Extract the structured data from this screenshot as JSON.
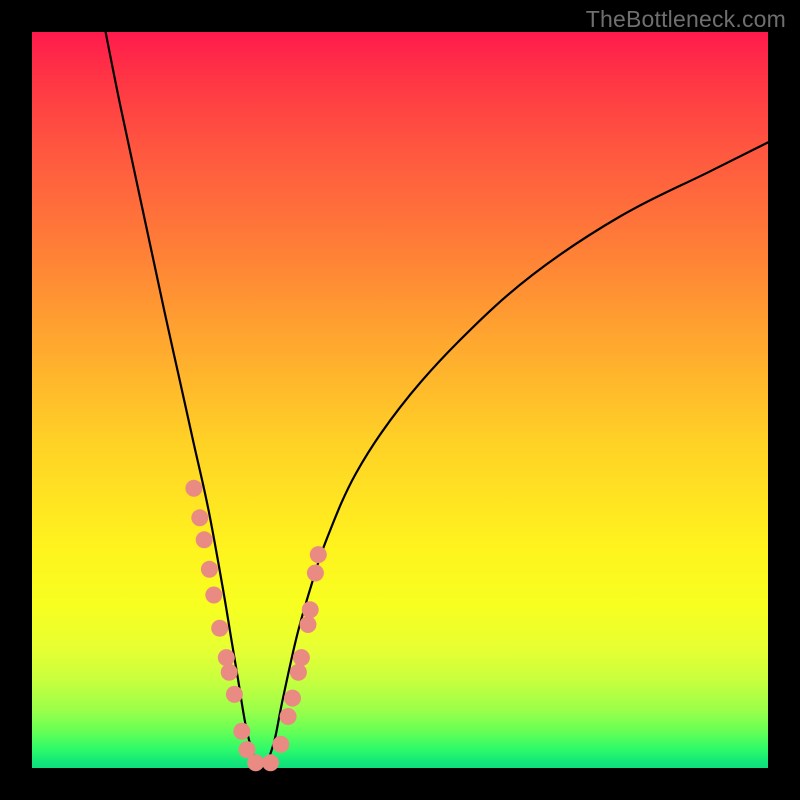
{
  "watermark": "TheBottleneck.com",
  "colors": {
    "frame": "#000000",
    "curve": "#000000",
    "dots": "#e98b83",
    "gradient_top": "#ff1a4d",
    "gradient_bottom": "#0fdd7d"
  },
  "chart_data": {
    "type": "line",
    "title": "",
    "xlabel": "",
    "ylabel": "",
    "xlim": [
      0,
      100
    ],
    "ylim": [
      0,
      100
    ],
    "grid": false,
    "notes": "V-shaped bottleneck curve. x ≈ relative GPU/CPU balance (0–100), y ≈ bottleneck % (0 best at bottom, 100 worst at top). Minimum (optimal balance) near x≈31. Salmon dots mark sampled hardware configurations clustered near the minimum.",
    "series": [
      {
        "name": "bottleneck-curve",
        "x": [
          10,
          12,
          15,
          18,
          20,
          22,
          24,
          26,
          27,
          28,
          29,
          30,
          31,
          32,
          33,
          34,
          36,
          38,
          40,
          44,
          50,
          58,
          68,
          80,
          92,
          100
        ],
        "y": [
          100,
          90,
          76,
          62,
          53,
          44,
          35,
          24,
          18,
          12,
          6,
          2,
          0,
          1,
          4,
          9,
          18,
          25,
          31,
          40,
          49,
          58,
          67,
          75,
          81,
          85
        ]
      }
    ],
    "points": {
      "name": "sampled-configs",
      "x": [
        22.0,
        22.8,
        23.4,
        24.1,
        24.7,
        25.5,
        26.4,
        26.8,
        27.5,
        28.5,
        29.2,
        30.4,
        32.4,
        33.8,
        34.8,
        35.4,
        36.2,
        36.6,
        37.5,
        37.8,
        38.5,
        38.9
      ],
      "y": [
        38.0,
        34.0,
        31.0,
        27.0,
        23.5,
        19.0,
        15.0,
        13.0,
        10.0,
        5.0,
        2.5,
        0.7,
        0.7,
        3.2,
        7.0,
        9.5,
        13.0,
        15.0,
        19.5,
        21.5,
        26.5,
        29.0
      ]
    }
  }
}
